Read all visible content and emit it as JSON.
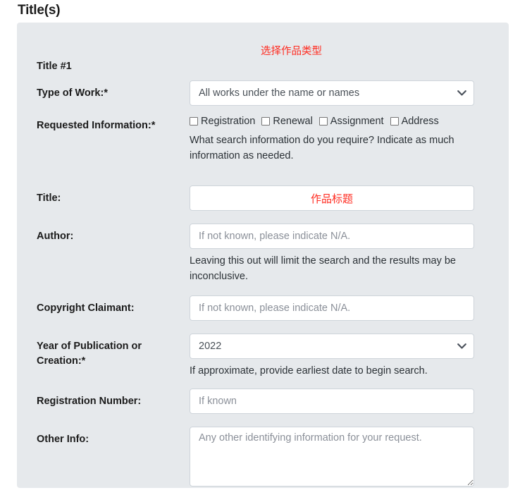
{
  "section": {
    "heading": "Title(s)",
    "subheading": "Title #1"
  },
  "fields": {
    "type_of_work": {
      "label": "Type of Work:*",
      "value": "All works under the name or names",
      "annotation": "选择作品类型",
      "chevron_icon": "chevron-down-icon"
    },
    "requested_information": {
      "label": "Requested Information:*",
      "options": [
        "Registration",
        "Renewal",
        "Assignment",
        "Address"
      ],
      "help": "What search information do you require? Indicate as much information as needed."
    },
    "title": {
      "label": "Title:",
      "value": "",
      "placeholder": "",
      "annotation": "作品标题"
    },
    "author": {
      "label": "Author:",
      "placeholder": "If not known, please indicate N/A.",
      "help": "Leaving this out will limit the search and the results may be inconclusive."
    },
    "copyright_claimant": {
      "label": "Copyright Claimant:",
      "placeholder": "If not known, please indicate N/A."
    },
    "year_of_publication": {
      "label": "Year of Publication or Creation:*",
      "value": "2022",
      "help": "If approximate, provide earliest date to begin search.",
      "chevron_icon": "chevron-down-icon"
    },
    "registration_number": {
      "label": "Registration Number:",
      "placeholder": "If known"
    },
    "other_info": {
      "label": "Other Info:",
      "placeholder": "Any other identifying information for your request."
    }
  },
  "colors": {
    "panel_bg": "#e6e9ec",
    "page_bg": "#ffffff",
    "label_text": "#1b1b1b",
    "annotation_red": "#ff2b20",
    "input_border": "#ced4da",
    "placeholder": "#8b9099"
  }
}
